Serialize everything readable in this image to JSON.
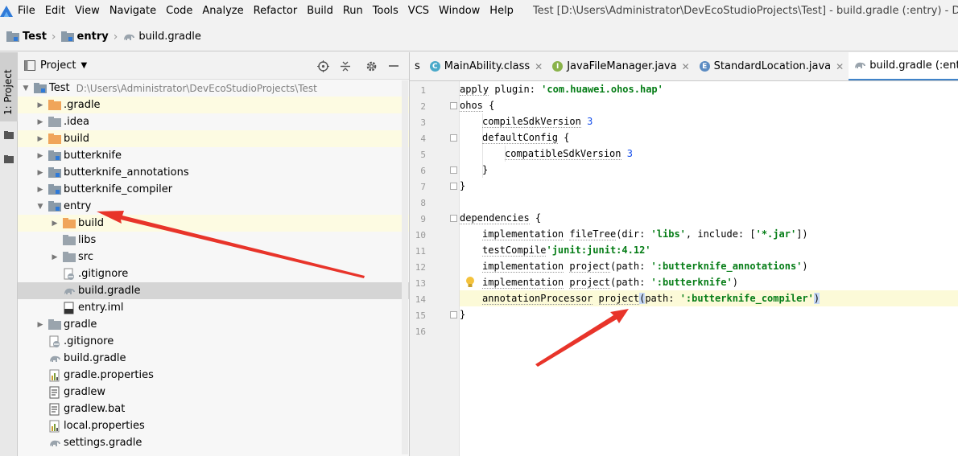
{
  "menubar": {
    "items": [
      "File",
      "Edit",
      "View",
      "Navigate",
      "Code",
      "Analyze",
      "Refactor",
      "Build",
      "Run",
      "Tools",
      "VCS",
      "Window",
      "Help"
    ],
    "window_title": "Test [D:\\Users\\Administrator\\DevEcoStudioProjects\\Test] - build.gradle (:entry) - DevE"
  },
  "breadcrumb": {
    "items": [
      "Test",
      "entry",
      "build.gradle"
    ]
  },
  "tool_stripe": {
    "project_label": "1: Project"
  },
  "project_panel": {
    "title": "Project",
    "tree": [
      {
        "name": "Test",
        "path": "D:\\Users\\Administrator\\DevEcoStudioProjects\\Test",
        "level": 0,
        "arrow": "open",
        "icon": "module-folder"
      },
      {
        "name": ".gradle",
        "level": 1,
        "arrow": "closed",
        "icon": "orange-folder",
        "hl": "yellow"
      },
      {
        "name": ".idea",
        "level": 1,
        "arrow": "closed",
        "icon": "gray-folder"
      },
      {
        "name": "build",
        "level": 1,
        "arrow": "closed",
        "icon": "orange-folder",
        "hl": "yellow"
      },
      {
        "name": "butterknife",
        "level": 1,
        "arrow": "closed",
        "icon": "module-folder"
      },
      {
        "name": "butterknife_annotations",
        "level": 1,
        "arrow": "closed",
        "icon": "module-folder"
      },
      {
        "name": "butterknife_compiler",
        "level": 1,
        "arrow": "closed",
        "icon": "module-folder"
      },
      {
        "name": "entry",
        "level": 1,
        "arrow": "open",
        "icon": "module-folder"
      },
      {
        "name": "build",
        "level": 2,
        "arrow": "closed",
        "icon": "orange-folder",
        "hl": "yellow"
      },
      {
        "name": "libs",
        "level": 2,
        "arrow": "none",
        "icon": "gray-folder"
      },
      {
        "name": "src",
        "level": 2,
        "arrow": "closed",
        "icon": "gray-folder"
      },
      {
        "name": ".gitignore",
        "level": 2,
        "arrow": "none",
        "icon": "gitignore-file"
      },
      {
        "name": "build.gradle",
        "level": 2,
        "arrow": "none",
        "icon": "gradle-file",
        "hl": "selected"
      },
      {
        "name": "entry.iml",
        "level": 2,
        "arrow": "none",
        "icon": "iml-file"
      },
      {
        "name": "gradle",
        "level": 1,
        "arrow": "closed",
        "icon": "gray-folder"
      },
      {
        "name": ".gitignore",
        "level": 1,
        "arrow": "none",
        "icon": "gitignore-file"
      },
      {
        "name": "build.gradle",
        "level": 1,
        "arrow": "none",
        "icon": "gradle-file"
      },
      {
        "name": "gradle.properties",
        "level": 1,
        "arrow": "none",
        "icon": "properties-file"
      },
      {
        "name": "gradlew",
        "level": 1,
        "arrow": "none",
        "icon": "script-file"
      },
      {
        "name": "gradlew.bat",
        "level": 1,
        "arrow": "none",
        "icon": "script-file"
      },
      {
        "name": "local.properties",
        "level": 1,
        "arrow": "none",
        "icon": "properties-file"
      },
      {
        "name": "settings.gradle",
        "level": 1,
        "arrow": "none",
        "icon": "gradle-file"
      }
    ]
  },
  "editor": {
    "tabs": [
      {
        "label": "s",
        "icon": "none",
        "close": false
      },
      {
        "label": "MainAbility.class",
        "icon": "class",
        "close": true
      },
      {
        "label": "JavaFileManager.java",
        "icon": "interface",
        "close": true
      },
      {
        "label": "StandardLocation.java",
        "icon": "enum",
        "close": true
      },
      {
        "label": "build.gradle (:entry",
        "icon": "gradle",
        "close": false,
        "active": true
      }
    ],
    "line_numbers": [
      "1",
      "2",
      "3",
      "4",
      "5",
      "6",
      "7",
      "8",
      "9",
      "10",
      "11",
      "12",
      "13",
      "14",
      "15",
      "16"
    ],
    "code": {
      "l1_a": "apply",
      "l1_b": " plugin: ",
      "l1_c": "'com.huawei.ohos.hap'",
      "l2_a": "ohos",
      "l2_b": " {",
      "l3_a": "compileSdkVersion",
      "l3_b": " ",
      "l3_c": "3",
      "l4_a": "defaultConfig",
      "l4_b": " {",
      "l5_a": "compatibleSdkVersion",
      "l5_b": " ",
      "l5_c": "3",
      "l6": "}",
      "l7": "}",
      "l9_a": "dependencies",
      "l9_b": " {",
      "l10_a": "implementation",
      "l10_b": " ",
      "l10_c": "fileTree",
      "l10_d": "(dir: ",
      "l10_e": "'libs'",
      "l10_f": ", include: [",
      "l10_g": "'*.jar'",
      "l10_h": "])",
      "l11_a": "testCompile",
      "l11_b": "'junit:junit:4.12'",
      "l12_a": "implementation",
      "l12_b": " ",
      "l12_c": "project",
      "l12_d": "(path: ",
      "l12_e": "':butterknife_annotations'",
      "l12_f": ")",
      "l13_a": "implementation",
      "l13_b": " ",
      "l13_c": "project",
      "l13_d": "(path: ",
      "l13_e": "':butterknife'",
      "l13_f": ")",
      "l14_a": "annotationProcessor",
      "l14_b": " ",
      "l14_c": "project",
      "l14_d": "(",
      "l14_e": "path: ",
      "l14_f": "':butterknife_compiler'",
      "l14_g": ")",
      "l15": "}"
    }
  },
  "colors": {
    "annotation_arrow": "#e8342a",
    "string": "#067d17",
    "number": "#1750eb",
    "current_line": "#fcfad8",
    "selection_row": "#d5d5d5",
    "excluded_row": "#fdfbe2"
  }
}
